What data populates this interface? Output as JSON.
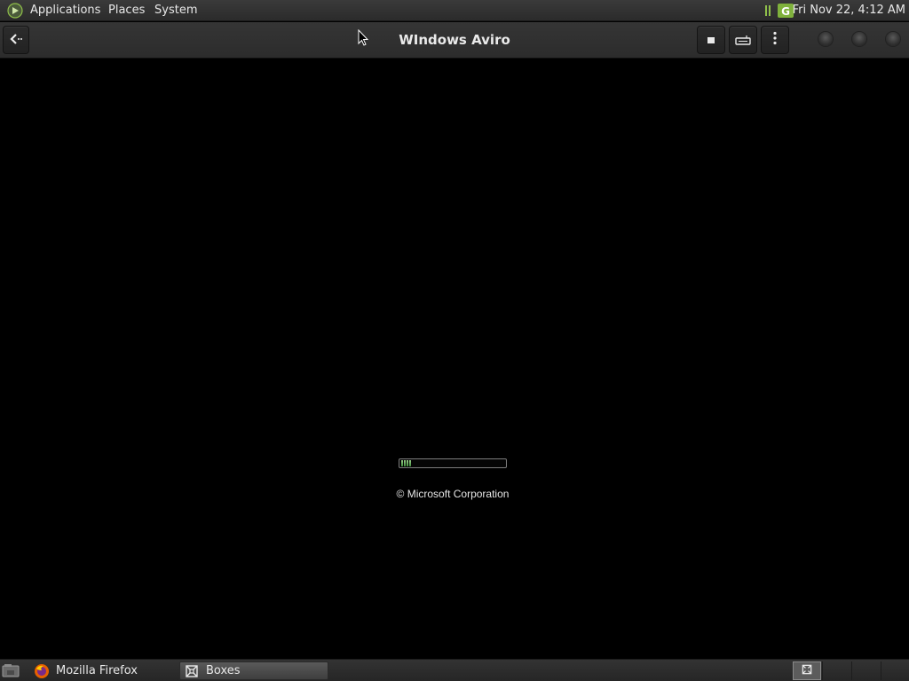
{
  "top_panel": {
    "menus": {
      "applications": "Applications",
      "places": "Places",
      "system": "System"
    },
    "clock": "Fri Nov 22,  4:12 AM",
    "icons": {
      "logo": "mint-logo-icon",
      "tray": "update-manager-icon"
    }
  },
  "header_bar": {
    "title": "WIndows Aviro",
    "buttons": {
      "back": "back-arrow-icon",
      "stop": "stop-icon",
      "keyboard": "keyboard-icon",
      "menu": "more-menu-icon"
    }
  },
  "vm": {
    "boot_progress_segments": 4,
    "copyright": "© Microsoft Corporation"
  },
  "taskbar": {
    "tasks": [
      {
        "label": "Mozilla Firefox",
        "icon": "firefox-icon",
        "active": false
      },
      {
        "label": "Boxes",
        "icon": "boxes-icon",
        "active": true
      }
    ],
    "workspaces": 4,
    "active_workspace": 1
  },
  "colors": {
    "panel_bg": "#2e2e2e",
    "vm_bg": "#000000",
    "progress_fill": "#6fb25f",
    "logo_green": "#8fbf4a"
  }
}
